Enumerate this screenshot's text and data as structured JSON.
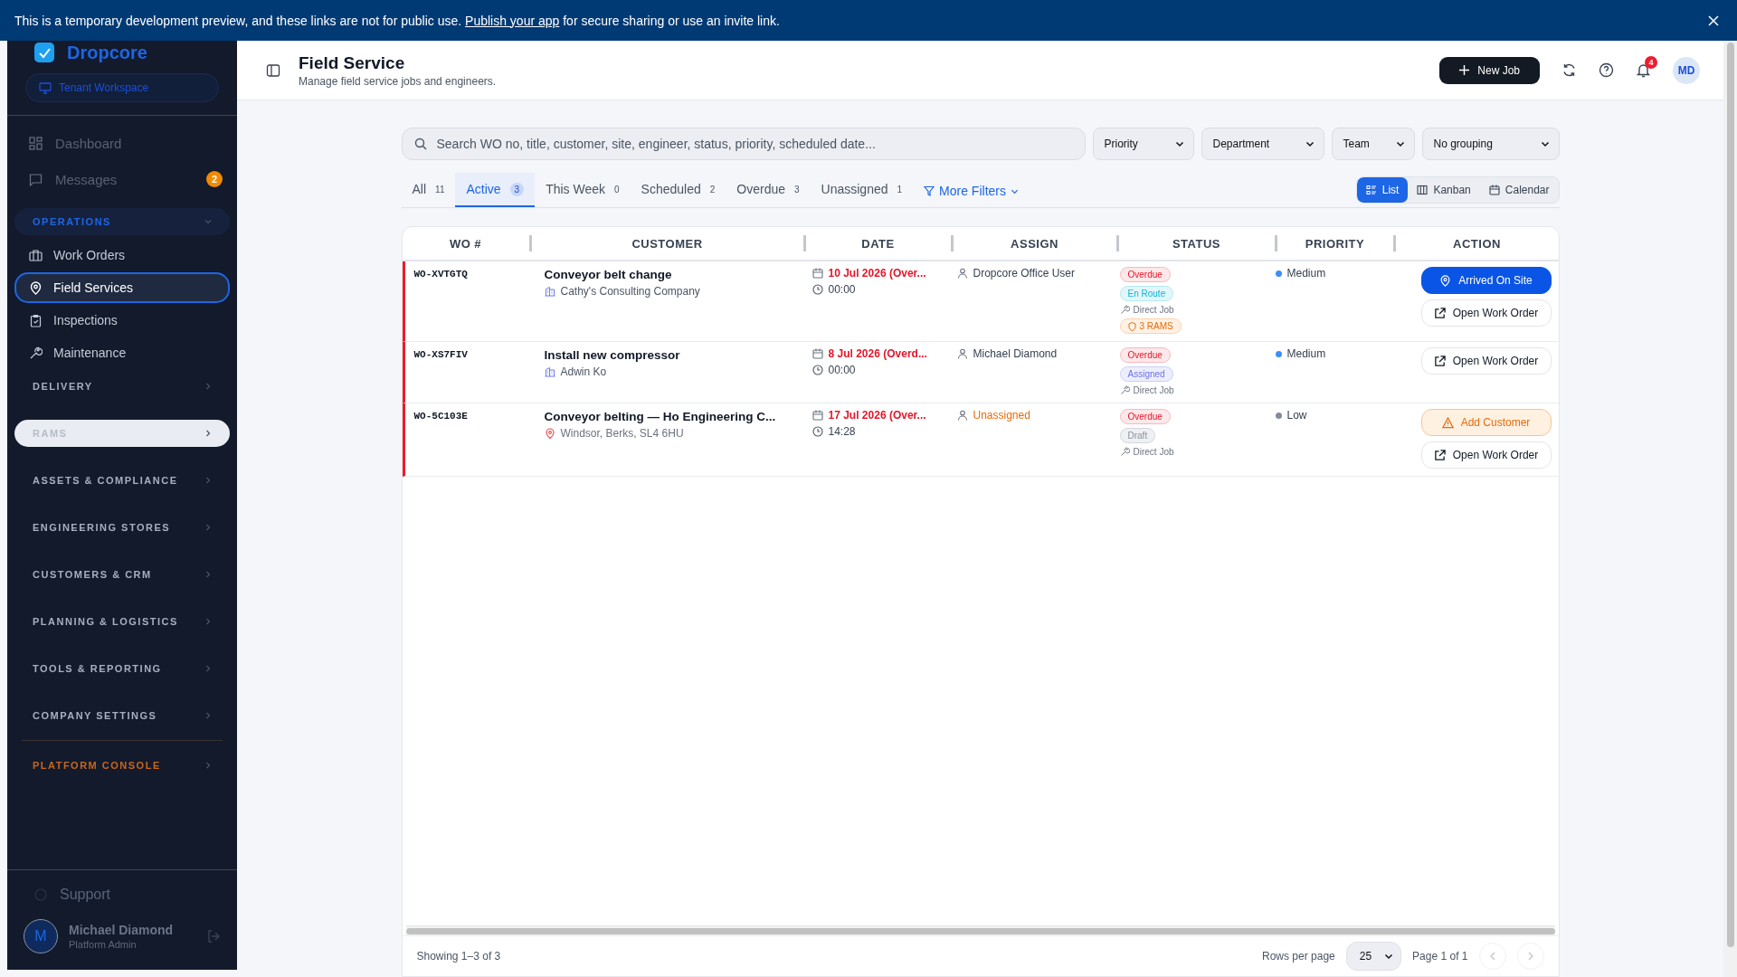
{
  "banner": {
    "before": "This is a temporary development preview, and these links are not for public use. ",
    "link": "Publish your app",
    "after": " for secure sharing or use an invite link."
  },
  "sidebar": {
    "brand": "Dropcore",
    "workspace": "Tenant Workspace",
    "items": [
      {
        "label": "Dashboard"
      },
      {
        "label": "Messages",
        "badge": "2"
      }
    ],
    "sections": [
      {
        "label": "OPERATIONS",
        "expanded": true,
        "highlighted": false,
        "kind": "normal",
        "children": [
          {
            "label": "Work Orders",
            "selected": false
          },
          {
            "label": "Field Services",
            "selected": true
          },
          {
            "label": "Inspections",
            "selected": false
          },
          {
            "label": "Maintenance",
            "selected": false
          }
        ]
      },
      {
        "label": "DELIVERY",
        "expanded": false,
        "highlighted": false,
        "kind": "normal"
      },
      {
        "label": "RAMS",
        "expanded": false,
        "highlighted": true,
        "kind": "normal"
      },
      {
        "label": "ASSETS & COMPLIANCE",
        "expanded": false,
        "highlighted": false,
        "kind": "normal"
      },
      {
        "label": "ENGINEERING STORES",
        "expanded": false,
        "highlighted": false,
        "kind": "normal"
      },
      {
        "label": "CUSTOMERS & CRM",
        "expanded": false,
        "highlighted": false,
        "kind": "normal"
      },
      {
        "label": "PLANNING & LOGISTICS",
        "expanded": false,
        "highlighted": false,
        "kind": "normal"
      },
      {
        "label": "TOOLS & REPORTING",
        "expanded": false,
        "highlighted": false,
        "kind": "normal"
      },
      {
        "label": "COMPANY SETTINGS",
        "expanded": false,
        "highlighted": false,
        "kind": "normal"
      },
      {
        "label": "PLATFORM CONSOLE",
        "expanded": false,
        "highlighted": false,
        "kind": "platform"
      }
    ],
    "support": "Support",
    "user": {
      "initial": "M",
      "name": "Michael Diamond",
      "role": "Platform Admin"
    }
  },
  "header": {
    "title": "Field Service",
    "subtitle": "Manage field service jobs and engineers.",
    "new_button": "New Job",
    "notifications": "4",
    "avatar": "MD"
  },
  "search": {
    "placeholder": "Search WO no, title, customer, site, engineer, status, priority, scheduled date..."
  },
  "filters": [
    {
      "value": "Priority"
    },
    {
      "value": "Department"
    },
    {
      "value": "Team"
    },
    {
      "value": "No grouping"
    }
  ],
  "tabs": [
    {
      "label": "All",
      "count": "11",
      "selected": false
    },
    {
      "label": "Active",
      "count": "3",
      "selected": true
    },
    {
      "label": "This Week",
      "count": "0",
      "selected": false
    },
    {
      "label": "Scheduled",
      "count": "2",
      "selected": false
    },
    {
      "label": "Overdue",
      "count": "3",
      "selected": false
    },
    {
      "label": "Unassigned",
      "count": "1",
      "selected": false
    }
  ],
  "more_filters": "More Filters",
  "views": [
    {
      "label": "List",
      "selected": true
    },
    {
      "label": "Kanban",
      "selected": false
    },
    {
      "label": "Calendar",
      "selected": false
    }
  ],
  "table": {
    "columns": [
      "WO #",
      "CUSTOMER",
      "DATE",
      "ASSIGN",
      "STATUS",
      "PRIORITY",
      "ACTION"
    ],
    "rows": [
      {
        "wo": "WO-XVTGTQ",
        "title": "Conveyor belt change",
        "sub": "Cathy's Consulting Company",
        "is_site": false,
        "date": "10 Jul 2026 (Over...",
        "overdue": true,
        "time": "00:00",
        "assignee": "Dropcore Office User",
        "unassigned": false,
        "status": [
          {
            "kind": "overdue",
            "label": "Overdue"
          },
          {
            "kind": "en-route",
            "label": "En Route"
          },
          {
            "kind": "job",
            "label": "Direct Job"
          },
          {
            "kind": "rams",
            "label": "3 RAMS"
          }
        ],
        "priority": {
          "label": "Medium",
          "color": "#3b8ff6"
        },
        "actions": [
          {
            "kind": "primary",
            "label": "Arrived On Site"
          },
          {
            "kind": "outline",
            "label": "Open Work Order"
          }
        ]
      },
      {
        "wo": "WO-XS7FIV",
        "title": "Install new compressor",
        "sub": "Adwin Ko",
        "is_site": false,
        "date": "8 Jul 2026 (Overd...",
        "overdue": true,
        "time": "00:00",
        "assignee": "Michael Diamond",
        "unassigned": false,
        "status": [
          {
            "kind": "overdue",
            "label": "Overdue"
          },
          {
            "kind": "assigned",
            "label": "Assigned"
          },
          {
            "kind": "job",
            "label": "Direct Job"
          }
        ],
        "priority": {
          "label": "Medium",
          "color": "#3b8ff6"
        },
        "actions": [
          {
            "kind": "outline",
            "label": "Open Work Order"
          }
        ]
      },
      {
        "wo": "WO-5C103E",
        "title": "Conveyor belting — Ho Engineering C...",
        "sub": "Windsor, Berks, SL4 6HU",
        "is_site": true,
        "date": "17 Jul 2026 (Over...",
        "overdue": true,
        "time": "14:28",
        "assignee": "Unassigned",
        "unassigned": true,
        "status": [
          {
            "kind": "overdue",
            "label": "Overdue"
          },
          {
            "kind": "draft",
            "label": "Draft"
          },
          {
            "kind": "job",
            "label": "Direct Job"
          }
        ],
        "priority": {
          "label": "Low",
          "color": "#868c97"
        },
        "actions": [
          {
            "kind": "warning",
            "label": "Add Customer"
          },
          {
            "kind": "outline",
            "label": "Open Work Order"
          }
        ]
      }
    ]
  },
  "footer": {
    "showing": "Showing 1–3 of 3",
    "rows_label": "Rows per page",
    "rows_value": "25",
    "page": "Page 1 of 1"
  }
}
